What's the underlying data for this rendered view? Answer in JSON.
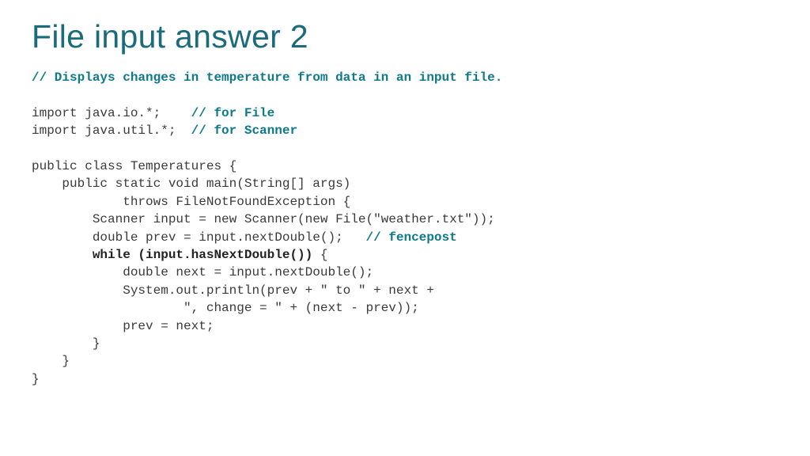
{
  "title": "File input answer 2",
  "code": {
    "l1": "// Displays changes in temperature from data in an input file.",
    "l2": "",
    "l3a": "import java.io.*;    ",
    "l3b": "// for File",
    "l4a": "import java.util.*;  ",
    "l4b": "// for Scanner",
    "l5": "",
    "l6": "public class Temperatures {",
    "l7": "    public static void main(String[] args)",
    "l8": "            throws FileNotFoundException {",
    "l9": "        Scanner input = new Scanner(new File(\"weather.txt\"));",
    "l10a": "        double prev = input.nextDouble();   ",
    "l10b": "// fencepost",
    "l11a": "        while (input.hasNextDouble())",
    "l11b": " {",
    "l12": "            double next = input.nextDouble();",
    "l13": "            System.out.println(prev + \" to \" + next +",
    "l14": "                    \", change = \" + (next - prev));",
    "l15": "            prev = next;",
    "l16": "        }",
    "l17": "    }",
    "l18": "}"
  }
}
